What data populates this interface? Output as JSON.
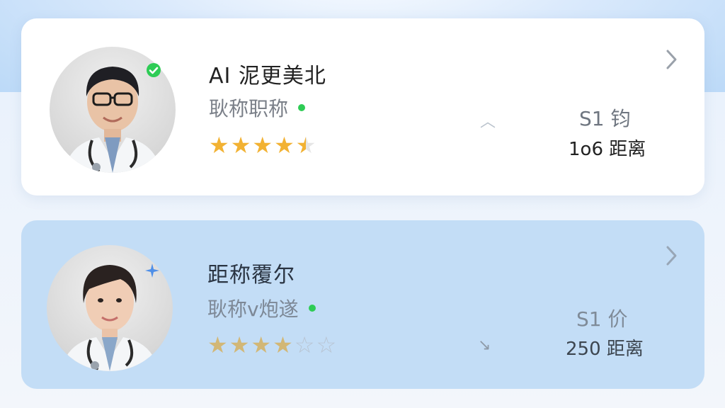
{
  "cards": [
    {
      "name": "AI 泥更美北",
      "title": "耿称职称",
      "online": true,
      "badge": "verified-check-icon",
      "rating": 4.5,
      "stars_display": "full,full,full,full,half",
      "price": "S1 钧",
      "distance": "1o6 距离",
      "mini_icon": "chevron-up-icon",
      "chevron": "chevron-right-icon"
    },
    {
      "name": "距称覆尔",
      "title": "耿称ⅴ炮遂",
      "online": true,
      "badge": "sparkle-icon",
      "rating": 4,
      "stars_display": "full,full,full,full,empty,empty",
      "price": "S1 价",
      "distance": "250 距离",
      "mini_icon": "chevron-down-right-icon",
      "chevron": "chevron-right-icon"
    }
  ],
  "colors": {
    "online": "#2ecc55",
    "star_active": "#f2b233",
    "star_muted": "#d2b776",
    "card_selected": "#c3ddf6",
    "card_default": "#ffffff"
  }
}
